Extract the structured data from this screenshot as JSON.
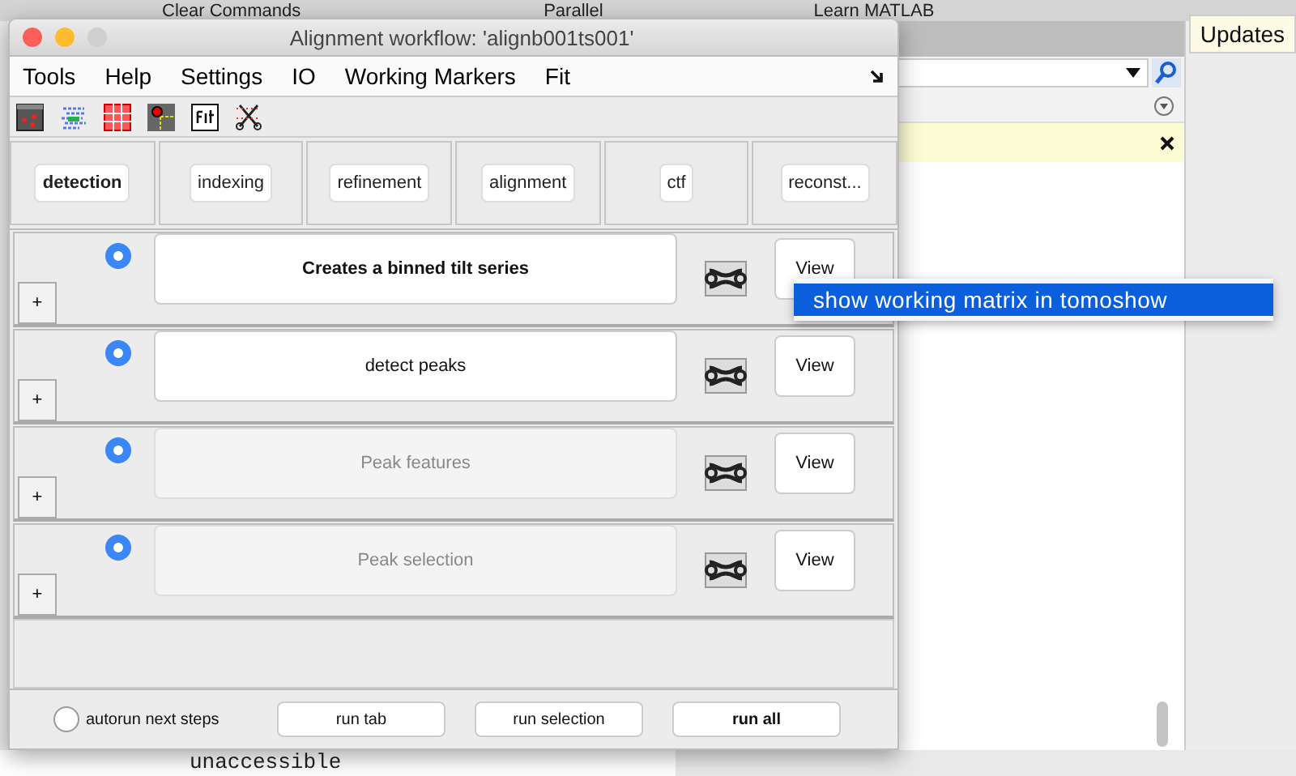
{
  "background": {
    "toolbar_items": [
      "Clear Commands",
      "Parallel",
      "Learn MATLAB"
    ],
    "updates_button": "Updates",
    "console_text": "unaccessible"
  },
  "window": {
    "title": "Alignment workflow: 'alignb001ts001'"
  },
  "menu": [
    "Tools",
    "Help",
    "Settings",
    "IO",
    "Working Markers",
    "Fit"
  ],
  "tabs": [
    {
      "label": "detection",
      "selected": true
    },
    {
      "label": "indexing",
      "selected": false
    },
    {
      "label": "refinement",
      "selected": false
    },
    {
      "label": "alignment",
      "selected": false
    },
    {
      "label": "ctf",
      "selected": false
    },
    {
      "label": "reconst...",
      "selected": false
    }
  ],
  "steps": [
    {
      "description": "Creates a binned tilt series",
      "selected": true,
      "enabled": true,
      "current": true,
      "expand": "+",
      "view": "View"
    },
    {
      "description": "detect peaks",
      "selected": true,
      "enabled": true,
      "current": false,
      "expand": "+",
      "view": "View"
    },
    {
      "description": "Peak features",
      "selected": true,
      "enabled": false,
      "current": false,
      "expand": "+",
      "view": "View"
    },
    {
      "description": "Peak selection",
      "selected": true,
      "enabled": false,
      "current": false,
      "expand": "+",
      "view": "View"
    }
  ],
  "footer": {
    "autorun": {
      "label": "autorun next steps",
      "checked": false
    },
    "buttons": [
      {
        "label": "run tab",
        "default": false
      },
      {
        "label": "run selection",
        "default": false
      },
      {
        "label": "run all",
        "default": true
      }
    ]
  },
  "context_menu": {
    "items": [
      {
        "label": "show working matrix in tomoshow",
        "selected": true
      }
    ]
  }
}
